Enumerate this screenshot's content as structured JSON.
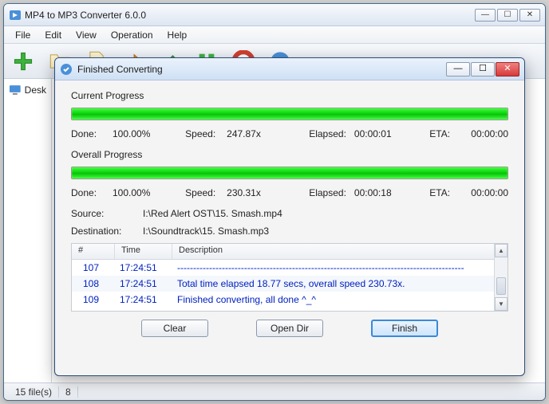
{
  "main": {
    "title": "MP4 to MP3 Converter 6.0.0",
    "menus": [
      "File",
      "Edit",
      "View",
      "Operation",
      "Help"
    ],
    "tree_item": "Desk",
    "status": {
      "files": "15 file(s)",
      "rest": "8"
    }
  },
  "dialog": {
    "title": "Finished Converting",
    "current": {
      "heading": "Current Progress",
      "done_label": "Done:",
      "done": "100.00%",
      "speed_label": "Speed:",
      "speed": "247.87x",
      "elapsed_label": "Elapsed:",
      "elapsed": "00:00:01",
      "eta_label": "ETA:",
      "eta": "00:00:00"
    },
    "overall": {
      "heading": "Overall Progress",
      "done_label": "Done:",
      "done": "100.00%",
      "speed_label": "Speed:",
      "speed": "230.31x",
      "elapsed_label": "Elapsed:",
      "elapsed": "00:00:18",
      "eta_label": "ETA:",
      "eta": "00:00:00"
    },
    "source_label": "Source:",
    "source": "I:\\Red Alert OST\\15. Smash.mp4",
    "dest_label": "Destination:",
    "dest": "I:\\Soundtrack\\15. Smash.mp3",
    "log": {
      "headers": {
        "num": "#",
        "time": "Time",
        "desc": "Description"
      },
      "rows": [
        {
          "num": "107",
          "time": "17:24:51",
          "desc": "------------------------------------------------------------------------------------------"
        },
        {
          "num": "108",
          "time": "17:24:51",
          "desc": "Total time elapsed 18.77 secs, overall speed 230.73x."
        },
        {
          "num": "109",
          "time": "17:24:51",
          "desc": "Finished converting, all done ^_^"
        }
      ]
    },
    "buttons": {
      "clear": "Clear",
      "open_dir": "Open Dir",
      "finish": "Finish"
    }
  }
}
